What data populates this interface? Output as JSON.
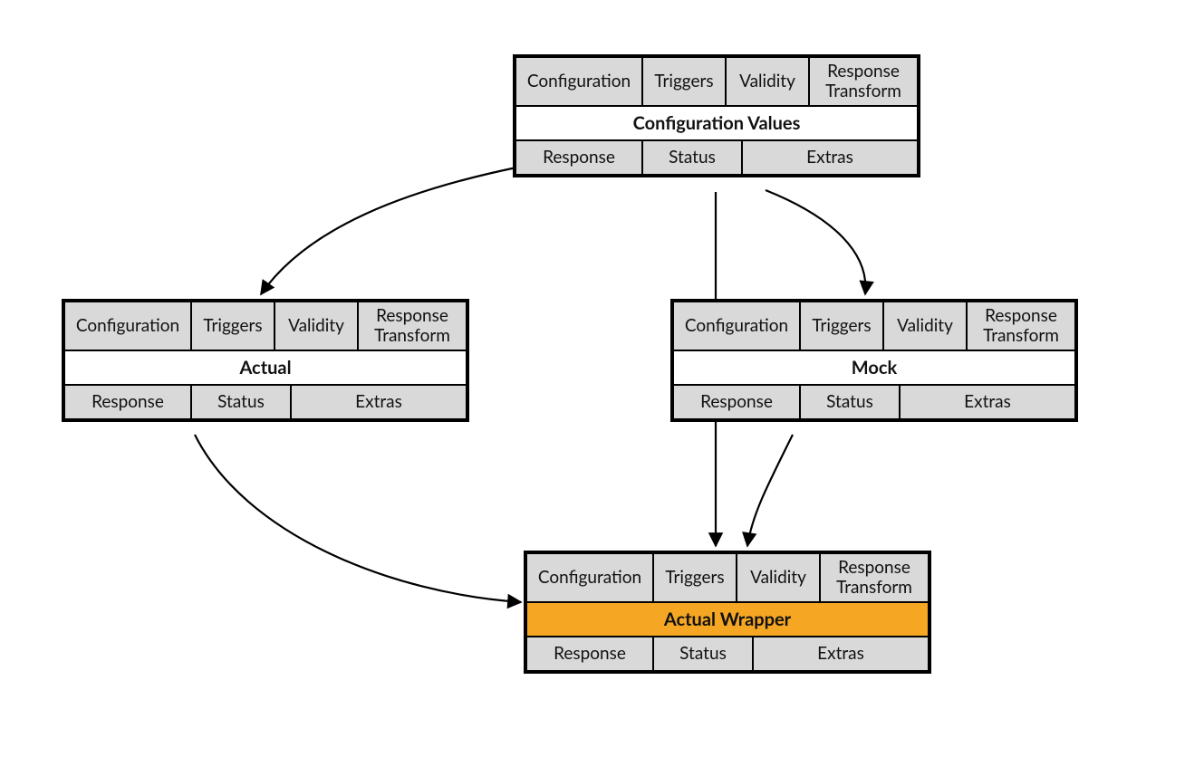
{
  "nodes": {
    "config": {
      "title": "Configuration Values",
      "highlight": false,
      "top": [
        "Configuration",
        "Triggers",
        "Validity",
        "Response Transform"
      ],
      "bottom": [
        "Response",
        "Status",
        "Extras"
      ]
    },
    "actual": {
      "title": "Actual",
      "highlight": false,
      "top": [
        "Configuration",
        "Triggers",
        "Validity",
        "Response Transform"
      ],
      "bottom": [
        "Response",
        "Status",
        "Extras"
      ]
    },
    "mock": {
      "title": "Mock",
      "highlight": false,
      "top": [
        "Configuration",
        "Triggers",
        "Validity",
        "Response Transform"
      ],
      "bottom": [
        "Response",
        "Status",
        "Extras"
      ]
    },
    "wrapper": {
      "title": "Actual Wrapper",
      "highlight": true,
      "top": [
        "Configuration",
        "Triggers",
        "Validity",
        "Response Transform"
      ],
      "bottom": [
        "Response",
        "Status",
        "Extras"
      ]
    }
  },
  "edges": [
    {
      "from": "config",
      "to": "actual"
    },
    {
      "from": "config",
      "to": "mock"
    },
    {
      "from": "config",
      "to": "wrapper"
    },
    {
      "from": "actual",
      "to": "wrapper"
    },
    {
      "from": "mock",
      "to": "wrapper"
    }
  ]
}
